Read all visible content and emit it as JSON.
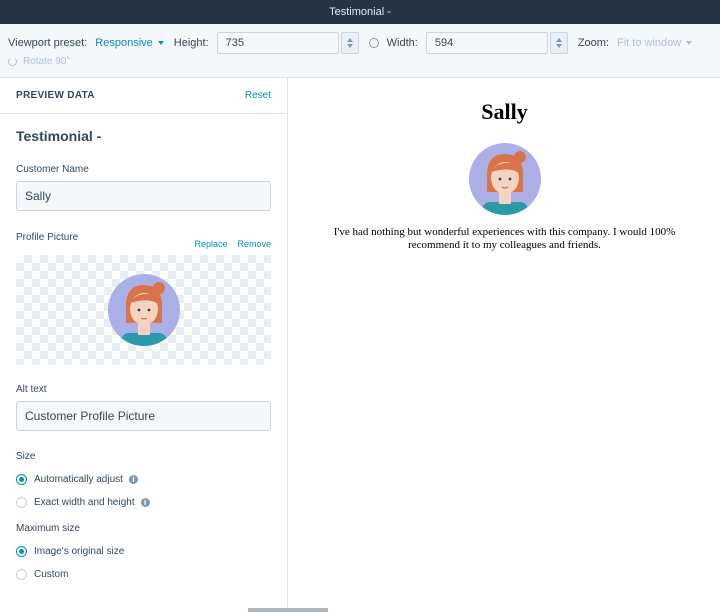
{
  "window": {
    "title": "Testimonial -"
  },
  "toolbar": {
    "viewport_label": "Viewport preset:",
    "viewport_value": "Responsive",
    "height_label": "Height:",
    "height_value": "735",
    "width_label": "Width:",
    "width_value": "594",
    "zoom_label": "Zoom:",
    "zoom_value": "Fit to window",
    "rotate_label": "Rotate 90°"
  },
  "sidebar": {
    "header_title": "PREVIEW DATA",
    "reset_label": "Reset",
    "module_title": "Testimonial -",
    "customer_name_label": "Customer Name",
    "customer_name_value": "Sally",
    "profile_picture_label": "Profile Picture",
    "replace_label": "Replace",
    "remove_label": "Remove",
    "alt_text_label": "Alt text",
    "alt_text_value": "Customer Profile Picture",
    "size_label": "Size",
    "size_options": [
      {
        "label": "Automatically adjust",
        "selected": true
      },
      {
        "label": "Exact width and height",
        "selected": false
      }
    ],
    "max_size_label": "Maximum size",
    "max_size_options": [
      {
        "label": "Image's original size",
        "selected": true
      },
      {
        "label": "Custom",
        "selected": false
      }
    ]
  },
  "preview": {
    "name": "Sally",
    "quote": "I've had nothing but wonderful experiences with this company. I would 100% recommend it to my colleagues and friends."
  },
  "colors": {
    "accent": "#0091ae",
    "titlebar": "#253342",
    "avatar_bg": "#aab0e6",
    "hair": "#d9744a",
    "shirt": "#2a9aa8"
  }
}
